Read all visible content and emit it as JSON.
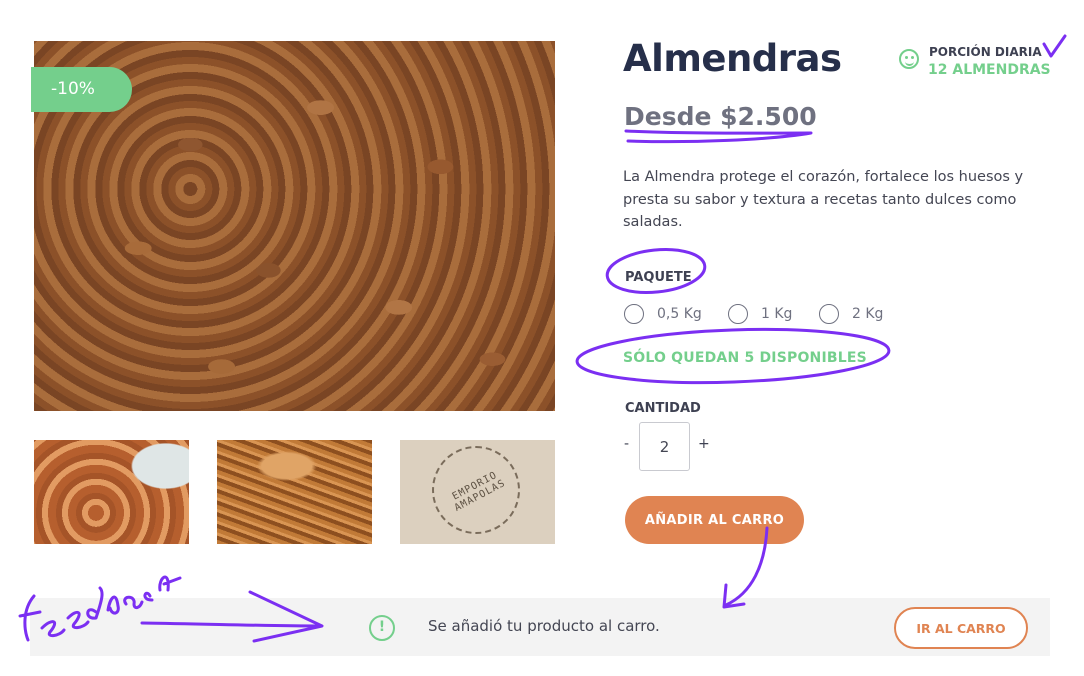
{
  "gallery": {
    "discount_badge": "-10%",
    "thumb_3_logo": "EMPORIO AMAPOLAS"
  },
  "product": {
    "title": "Almendras",
    "price": "Desde $2.500",
    "description": "La Almendra protege el corazón, fortalece los huesos y presta su sabor y textura a recetas tanto dulces como saladas.",
    "portion": {
      "label": "PORCIÓN DIARIA",
      "value": "12 ALMENDRAS",
      "icon": "smiley-icon"
    },
    "package": {
      "label": "PAQUETE",
      "options": [
        "0,5 Kg",
        "1 Kg",
        "2 Kg"
      ]
    },
    "stock_message": "SÓLO QUEDAN 5 DISPONIBLES",
    "quantity": {
      "label": "CANTIDAD",
      "minus": "-",
      "value": "2",
      "plus": "+"
    },
    "add_to_cart": "AÑADIR AL CARRO"
  },
  "feedback": {
    "icon": "alert-circle-icon",
    "message": "Se añadió tu producto al carro.",
    "go_to_cart": "IR AL CARRO"
  },
  "annotations": {
    "handwritten_note": "feedback",
    "ink_color": "#7b2ff2"
  },
  "colors": {
    "accent_green": "#74cf8c",
    "accent_orange": "#e08452",
    "title_navy": "#262f4a"
  }
}
